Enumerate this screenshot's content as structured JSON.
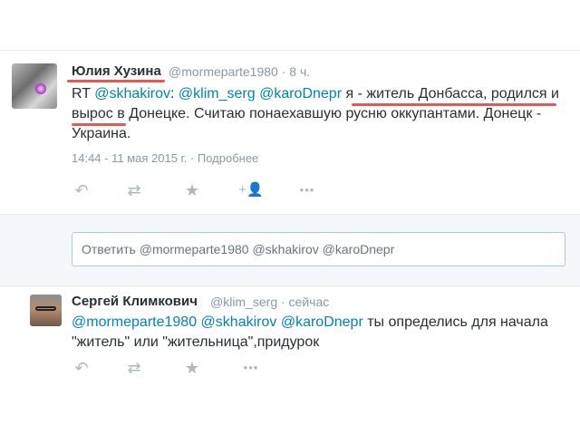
{
  "tweet1": {
    "name": "Юлия Хузина",
    "meta": "@mormeparte1980 · 8 ч.",
    "rt": "RT ",
    "mention_skhakirov": "@skhakirov",
    "colon": ": ",
    "mention_klim": "@klim_serg",
    "mention_karo": "@karoDnepr",
    "body": " я - житель Донбасса, родился и вырос в Донецке. Считаю понаехавшую русню оккупантами. Донецк - Украина.",
    "timestamp": "14:44 - 11 мая 2015 г. · Подробнее"
  },
  "reply": {
    "value": "Ответить @mormeparte1980 @skhakirov @karoDnepr"
  },
  "tweet2": {
    "name": "Сергей Климкович",
    "meta": "@klim_serg · сейчас",
    "mention_mormeparte": "@mormeparte1980",
    "mention_skhakirov": "@skhakirov",
    "mention_karo": "@karoDnepr",
    "body": " ты определись для начала \"житель\" или \"жительница\",придурок"
  },
  "icons": {
    "reply": "↶",
    "retweet": "⇄",
    "favorite": "★",
    "follow": "+👤",
    "more": "•••"
  },
  "colors": {
    "link": "#0084b4",
    "muted": "#8899a6",
    "underline": "#e53935"
  }
}
